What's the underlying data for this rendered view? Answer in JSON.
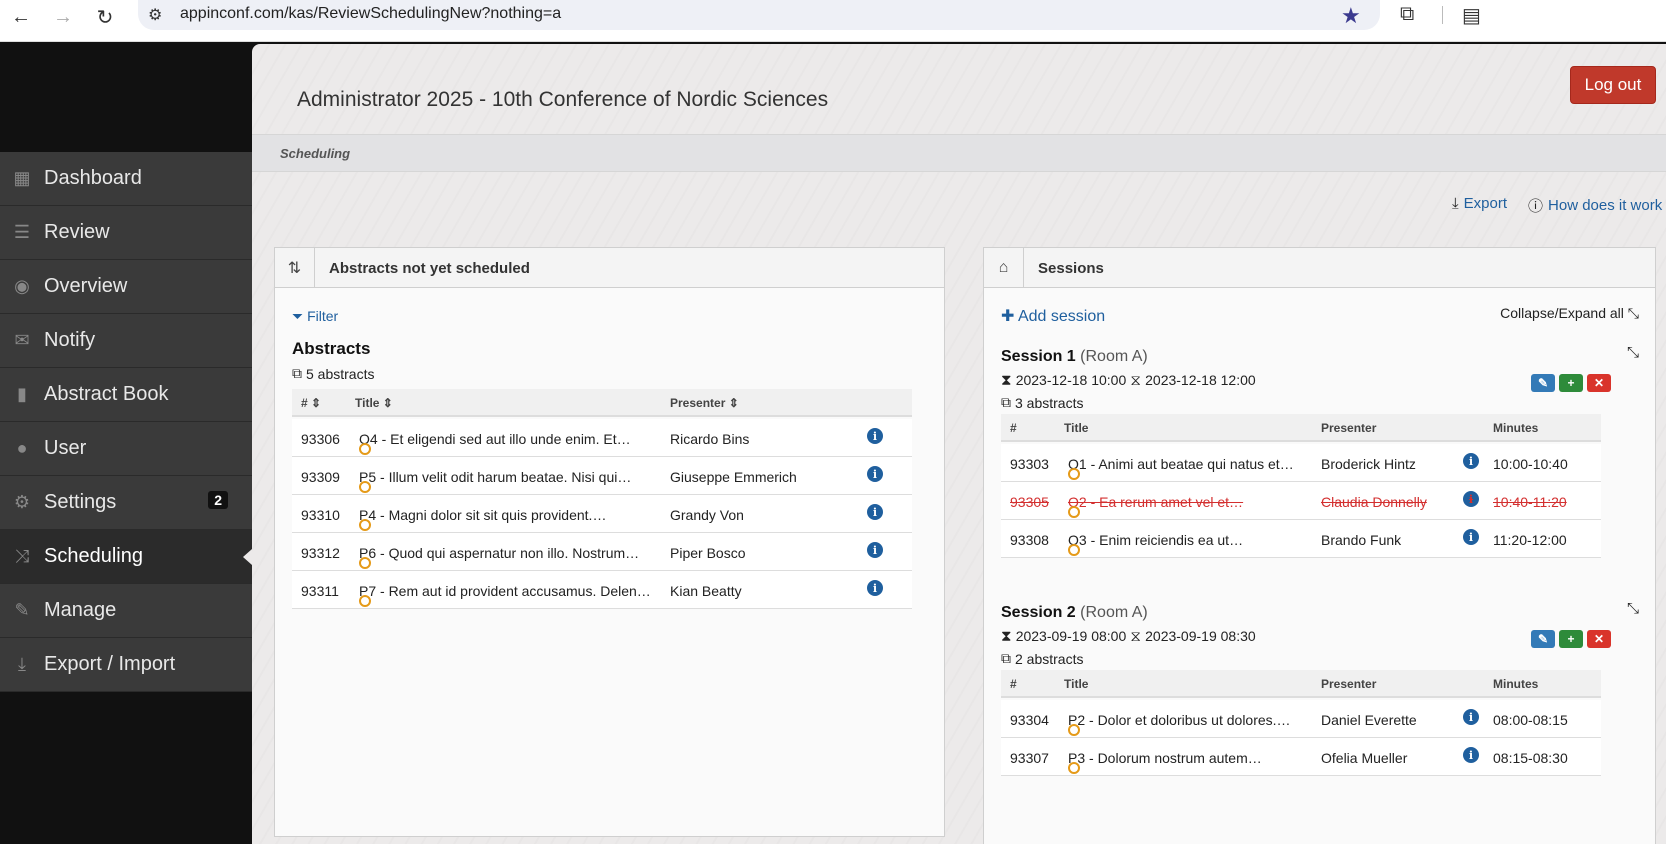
{
  "browser": {
    "url": "appinconf.com/kas/ReviewSchedulingNew?nothing=a",
    "icons": [
      "back-arrow-icon",
      "forward-arrow-icon",
      "reload-icon",
      "site-settings-icon",
      "bookmark-star-icon",
      "extensions-icon",
      "reading-list-icon"
    ]
  },
  "sidebar": {
    "items": [
      {
        "label": "Dashboard",
        "icon": "grid-icon",
        "glyph": "▦"
      },
      {
        "label": "Review",
        "icon": "list-icon",
        "glyph": "☰"
      },
      {
        "label": "Overview",
        "icon": "eye-icon",
        "glyph": "◉"
      },
      {
        "label": "Notify",
        "icon": "envelope-icon",
        "glyph": "✉"
      },
      {
        "label": "Abstract Book",
        "icon": "book-icon",
        "glyph": "▮"
      },
      {
        "label": "User",
        "icon": "user-icon",
        "glyph": "●"
      },
      {
        "label": "Settings",
        "icon": "gear-icon",
        "glyph": "⚙",
        "badge": "2"
      },
      {
        "label": "Scheduling",
        "icon": "shuffle-icon",
        "glyph": "⤨"
      },
      {
        "label": "Manage",
        "icon": "wrench-icon",
        "glyph": "✎"
      },
      {
        "label": "Export / Import",
        "icon": "download-icon",
        "glyph": "⤓"
      }
    ],
    "active": "Scheduling"
  },
  "header": {
    "title": "Administrator 2025 - 10th Conference of Nordic Sciences",
    "logout_label": "Log out",
    "breadcrumb": "Scheduling",
    "export_label": "Export",
    "how_label": "How does it work"
  },
  "unscheduled": {
    "panel_title": "Abstracts not yet scheduled",
    "filter_label": "Filter",
    "heading": "Abstracts",
    "count_label": "5 abstracts",
    "columns": {
      "id": "#",
      "title": "Title",
      "presenter": "Presenter"
    },
    "rows": [
      {
        "id": "93306",
        "title": "O4 - Et eligendi sed aut illo unde enim. Et…",
        "presenter": "Ricardo Bins"
      },
      {
        "id": "93309",
        "title": "P5 - Illum velit odit harum beatae. Nisi qui…",
        "presenter": "Giuseppe Emmerich"
      },
      {
        "id": "93310",
        "title": "P4 - Magni dolor sit sit quis provident.…",
        "presenter": "Grandy Von"
      },
      {
        "id": "93312",
        "title": "P6 - Quod qui aspernatur non illo. Nostrum…",
        "presenter": "Piper Bosco"
      },
      {
        "id": "93311",
        "title": "P7 - Rem aut id provident accusamus. Delen…",
        "presenter": "Kian Beatty"
      }
    ]
  },
  "sessions": {
    "panel_title": "Sessions",
    "add_label": "Add session",
    "collapse_label": "Collapse/Expand all",
    "columns": {
      "id": "#",
      "title": "Title",
      "presenter": "Presenter",
      "minutes": "Minutes"
    },
    "list": [
      {
        "name": "Session 1",
        "room": "(Room A)",
        "start": "2023-12-18 10:00",
        "end": "2023-12-18 12:00",
        "count_label": "3 abstracts",
        "rows": [
          {
            "id": "93303",
            "title": "O1 - Animi aut beatae qui natus et…",
            "presenter": "Broderick Hintz",
            "minutes": "10:00-10:40",
            "struck": false
          },
          {
            "id": "93305",
            "title": "O2 - Ea rerum amet vel et…",
            "presenter": "Claudia Donnelly",
            "minutes": "10:40-11:20",
            "struck": true
          },
          {
            "id": "93308",
            "title": "O3 - Enim reiciendis ea ut…",
            "presenter": "Brando Funk",
            "minutes": "11:20-12:00",
            "struck": false
          }
        ]
      },
      {
        "name": "Session 2",
        "room": "(Room A)",
        "start": "2023-09-19 08:00",
        "end": "2023-09-19 08:30",
        "count_label": "2 abstracts",
        "rows": [
          {
            "id": "93304",
            "title": "P2 - Dolor et doloribus ut dolores.…",
            "presenter": "Daniel Everette",
            "minutes": "08:00-08:15",
            "struck": false
          },
          {
            "id": "93307",
            "title": "P3 - Dolorum nostrum autem…",
            "presenter": "Ofelia Mueller",
            "minutes": "08:15-08:30",
            "struck": false
          }
        ]
      }
    ]
  },
  "colors": {
    "accent": "#1f5f9e",
    "danger": "#c0392b",
    "pending_dot": "#e59a18",
    "sidebar": "#3a3a3a"
  }
}
